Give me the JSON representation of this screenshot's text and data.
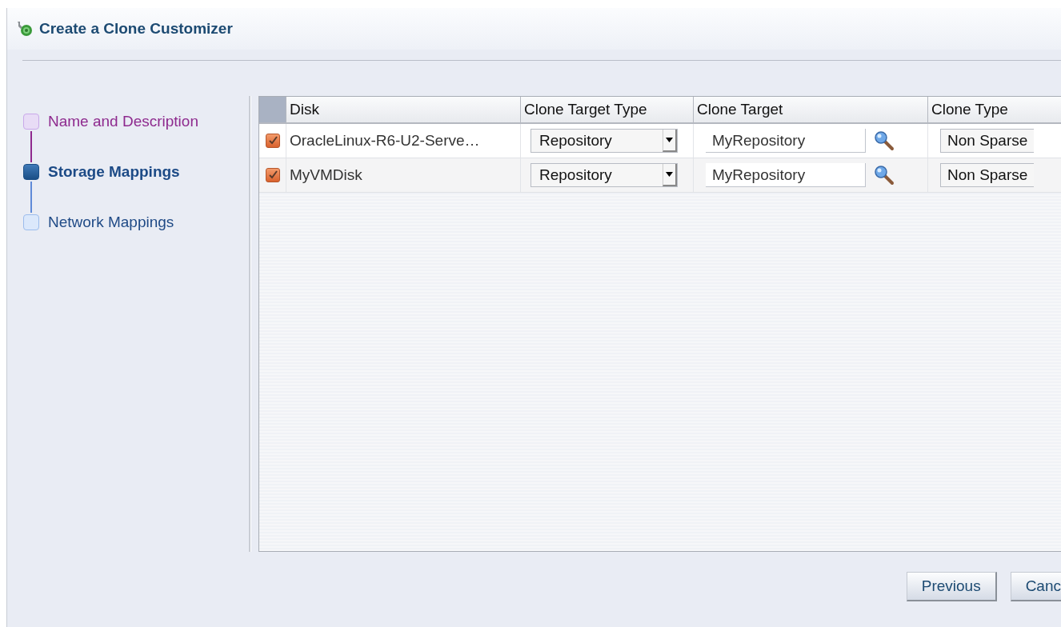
{
  "dialog": {
    "title": "Create a Clone Customizer"
  },
  "steps": [
    {
      "label": "Name and Description",
      "selected": false,
      "visited": true
    },
    {
      "label": "Storage Mappings",
      "selected": true,
      "visited": false
    },
    {
      "label": "Network Mappings",
      "selected": false,
      "visited": false
    }
  ],
  "table": {
    "columns": [
      "Disk",
      "Clone Target Type",
      "Clone Target",
      "Clone Type"
    ],
    "rows": [
      {
        "checked": true,
        "disk": "OracleLinux-R6-U2-Serve…",
        "target_type": "Repository",
        "target": "MyRepository",
        "clone_type": "Non Sparse"
      },
      {
        "checked": true,
        "disk": "MyVMDisk",
        "target_type": "Repository",
        "target": "MyRepository",
        "clone_type": "Non Sparse"
      }
    ]
  },
  "buttons": [
    "Previous",
    "Canc"
  ]
}
